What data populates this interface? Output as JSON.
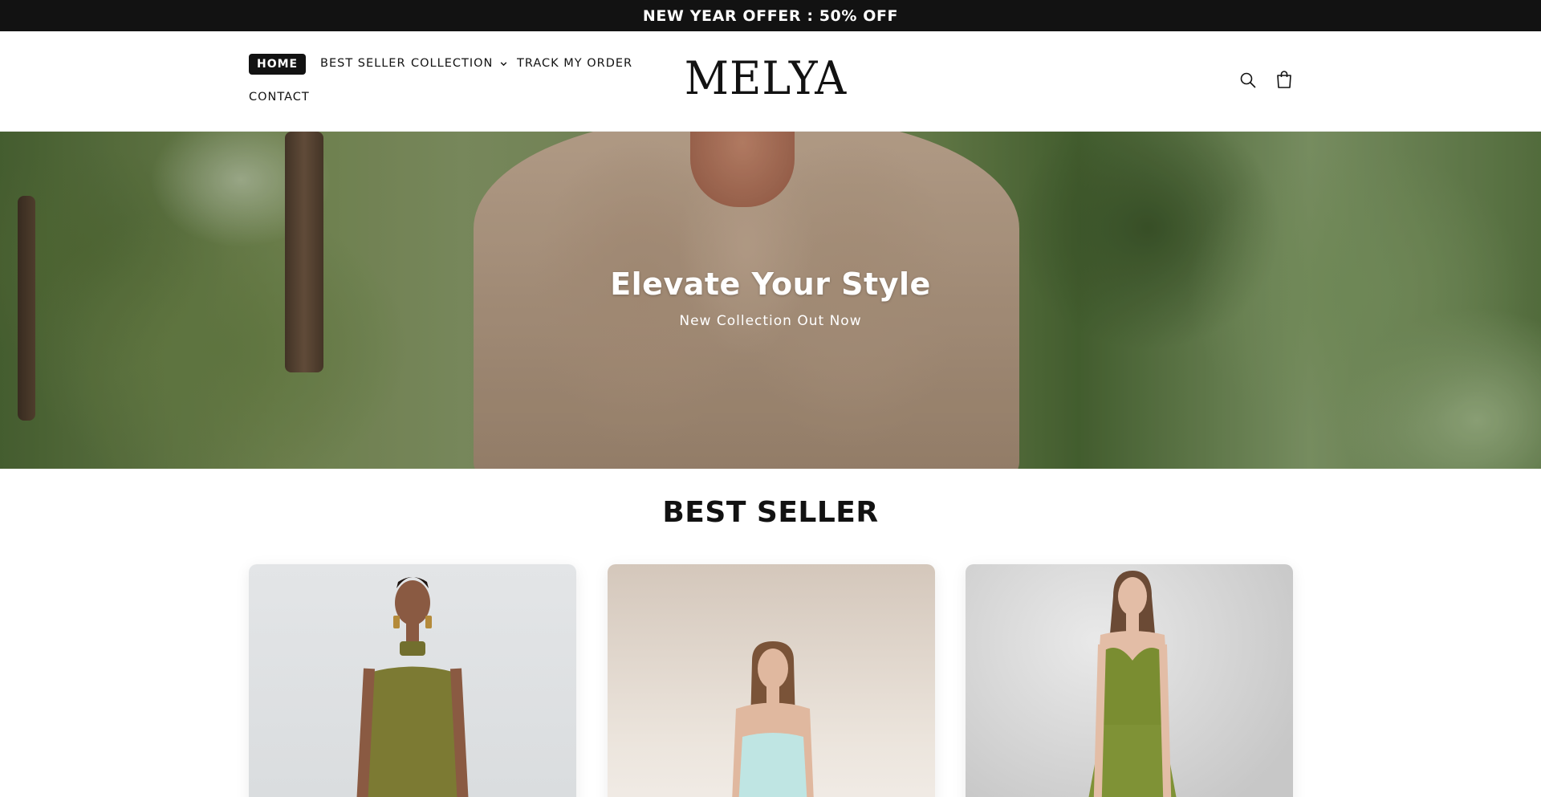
{
  "announcement": {
    "text": "NEW YEAR OFFER : 50% OFF"
  },
  "header": {
    "nav": {
      "home": "HOME",
      "best_seller": "BEST SELLER",
      "collection": "COLLECTION",
      "track_order": "TRACK MY ORDER",
      "contact": "CONTACT"
    },
    "logo": "MELYA",
    "icons": [
      "search-icon",
      "cart-icon",
      "chevron-down-icon"
    ]
  },
  "hero": {
    "title": "Elevate Your Style",
    "subtitle": "New Collection Out Now"
  },
  "best_seller": {
    "title": "BEST SELLER",
    "products": [
      {
        "dress_color": "#7c7a33"
      },
      {
        "dress_color": "#bfe5e3"
      },
      {
        "dress_color": "#7f9236"
      }
    ]
  },
  "colors": {
    "dark": "#121212",
    "white": "#ffffff"
  }
}
